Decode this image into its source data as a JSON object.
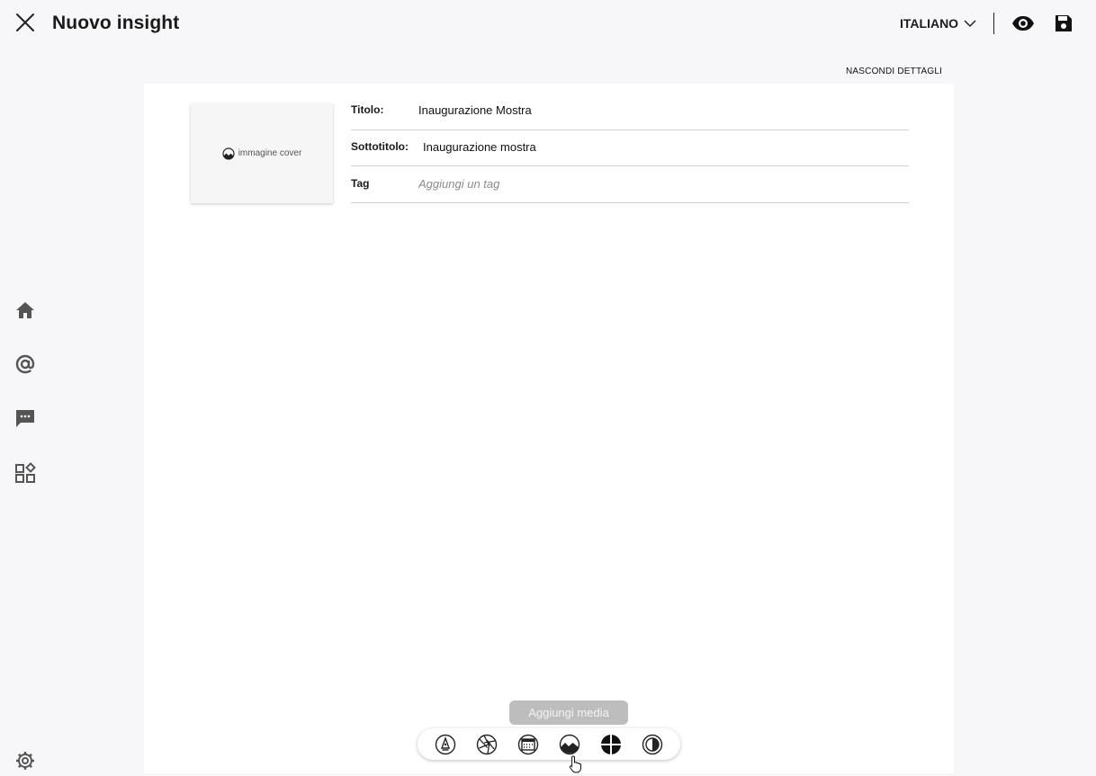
{
  "header": {
    "title": "Nuovo insight",
    "language": "ITALIANO",
    "icons": [
      "close-icon",
      "chevron-down-icon",
      "eye-icon",
      "save-icon"
    ]
  },
  "sidebar": {
    "items": [
      {
        "icon": "home-icon"
      },
      {
        "icon": "at-sign-icon"
      },
      {
        "icon": "chat-icon"
      },
      {
        "icon": "widgets-icon"
      },
      {
        "icon": "gear-icon"
      }
    ]
  },
  "details": {
    "toggle_label": "NASCONDI DETTAGLI",
    "cover_label": "immagine cover",
    "fields": {
      "title_label": "Titolo:",
      "title_value": "Inaugurazione Mostra",
      "subtitle_label": "Sottotitolo:",
      "subtitle_value": "Inaugurazione mostra",
      "tag_label": "Tag",
      "tag_placeholder": "Aggiungi un tag"
    }
  },
  "toolbar": {
    "tooltip": "Aggiungi media",
    "tools": [
      "pen-tool-icon",
      "aperture-icon",
      "calendar-icon",
      "image-icon",
      "crosshair-icon",
      "contrast-icon"
    ]
  },
  "colors": {
    "background": "#f7f7f9",
    "canvas": "#ffffff",
    "text": "#1a1a1a",
    "tooltip_bg": "#bdbdbd"
  }
}
